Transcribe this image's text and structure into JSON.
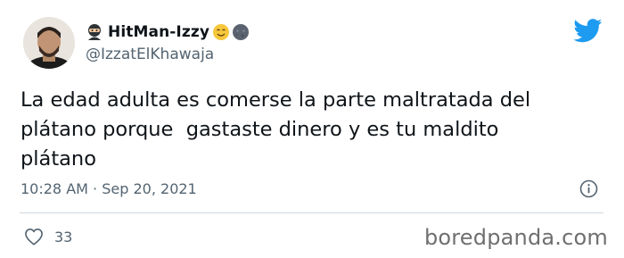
{
  "author": {
    "display_name": "HitMan-Izzy",
    "handle": "@IzzatElKhawaja",
    "name_icons": [
      "ninja-icon",
      "smiling-face-icon",
      "new-moon-face-icon"
    ]
  },
  "tweet": {
    "text": "La edad adulta es comerse la parte maltratada del\nplátano porque  gastaste dinero y es tu maldito\nplátano",
    "time": "10:28 AM",
    "separator": "·",
    "date": "Sep 20, 2021",
    "likes": "33"
  },
  "watermark": "boredpanda.com",
  "colors": {
    "brand": "#1d9bf0",
    "text": "#0f1419",
    "secondary": "#536471",
    "divider": "#cfd9de"
  }
}
